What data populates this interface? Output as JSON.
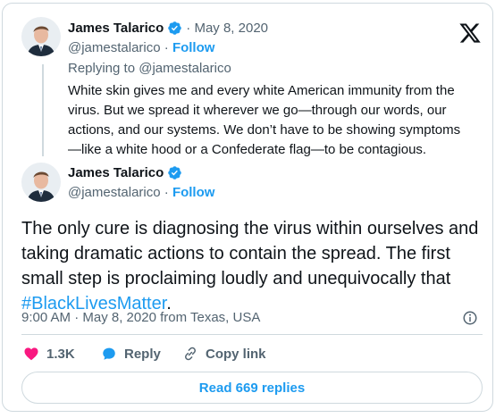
{
  "quoted_tweet": {
    "author_name": "James Talarico",
    "date": "· May 8, 2020",
    "handle": "@jamestalarico",
    "follow_label": "Follow",
    "replying_to": "Replying to @jamestalarico",
    "text": "White skin gives me and every white American immunity from the\nvirus. But we spread it wherever we go—through our words, our\nactions, and our systems. We don’t have to be showing symptoms\n—like a white hood or a Confederate flag—to be contagious."
  },
  "main_tweet": {
    "author_name": "James Talarico",
    "handle": "@jamestalarico",
    "follow_label": "Follow",
    "text_before": "The only cure is diagnosing the virus within ourselves and\ntaking dramatic actions to contain the spread. The first\nsmall step is proclaiming loudly and unequivocally that\n",
    "hashtag": "#BlackLivesMatter",
    "text_after": ".",
    "timestamp": "9:00 AM · May 8, 2020 from Texas, USA"
  },
  "actions": {
    "like_count": "1.3K",
    "reply_label": "Reply",
    "copy_link_label": "Copy link"
  },
  "read_replies_label": "Read 669 replies",
  "colors": {
    "accent": "#1d9bf0",
    "like": "#f91880",
    "muted": "#536471",
    "border": "#cfd9de"
  },
  "icons": [
    "verified-badge-icon",
    "x-logo-icon",
    "info-icon",
    "heart-icon",
    "reply-bubble-icon",
    "link-icon"
  ]
}
